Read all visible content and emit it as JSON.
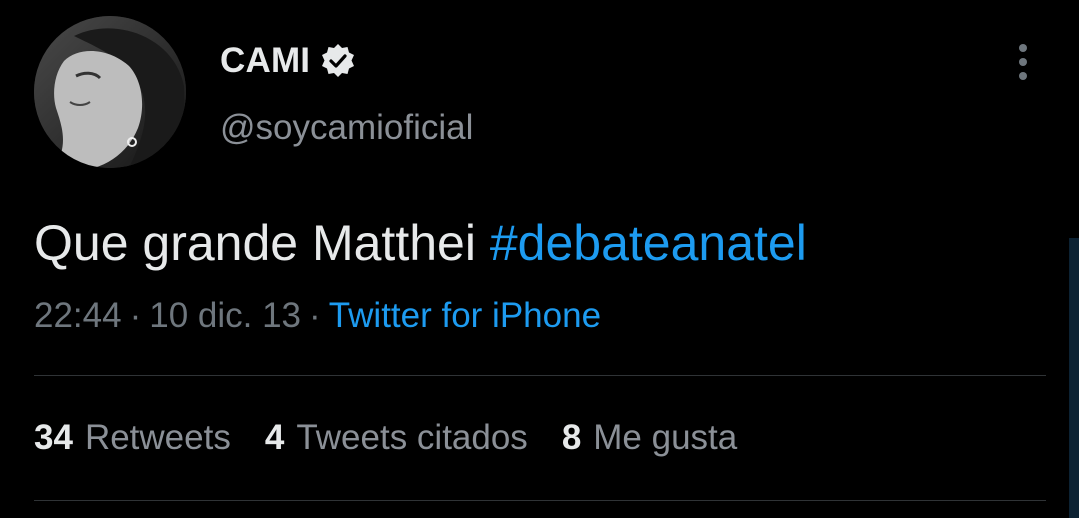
{
  "author": {
    "name": "CAMI",
    "handle": "@soycamioficial",
    "verified": true
  },
  "tweet": {
    "text": "Que grande Matthei",
    "hashtag": "#debateanatel",
    "time": "22:44",
    "date": "10 dic. 13",
    "separator": "·",
    "source": "Twitter for iPhone"
  },
  "stats": [
    {
      "count": "34",
      "label": "Retweets"
    },
    {
      "count": "4",
      "label": "Tweets citados"
    },
    {
      "count": "8",
      "label": "Me gusta"
    }
  ],
  "colors": {
    "background": "#000000",
    "accent": "#1d9bf0",
    "text": "#e7e9ea",
    "muted": "#6e767d"
  },
  "icons": {
    "verified": "verified-badge-icon",
    "more": "more-vertical-icon"
  }
}
